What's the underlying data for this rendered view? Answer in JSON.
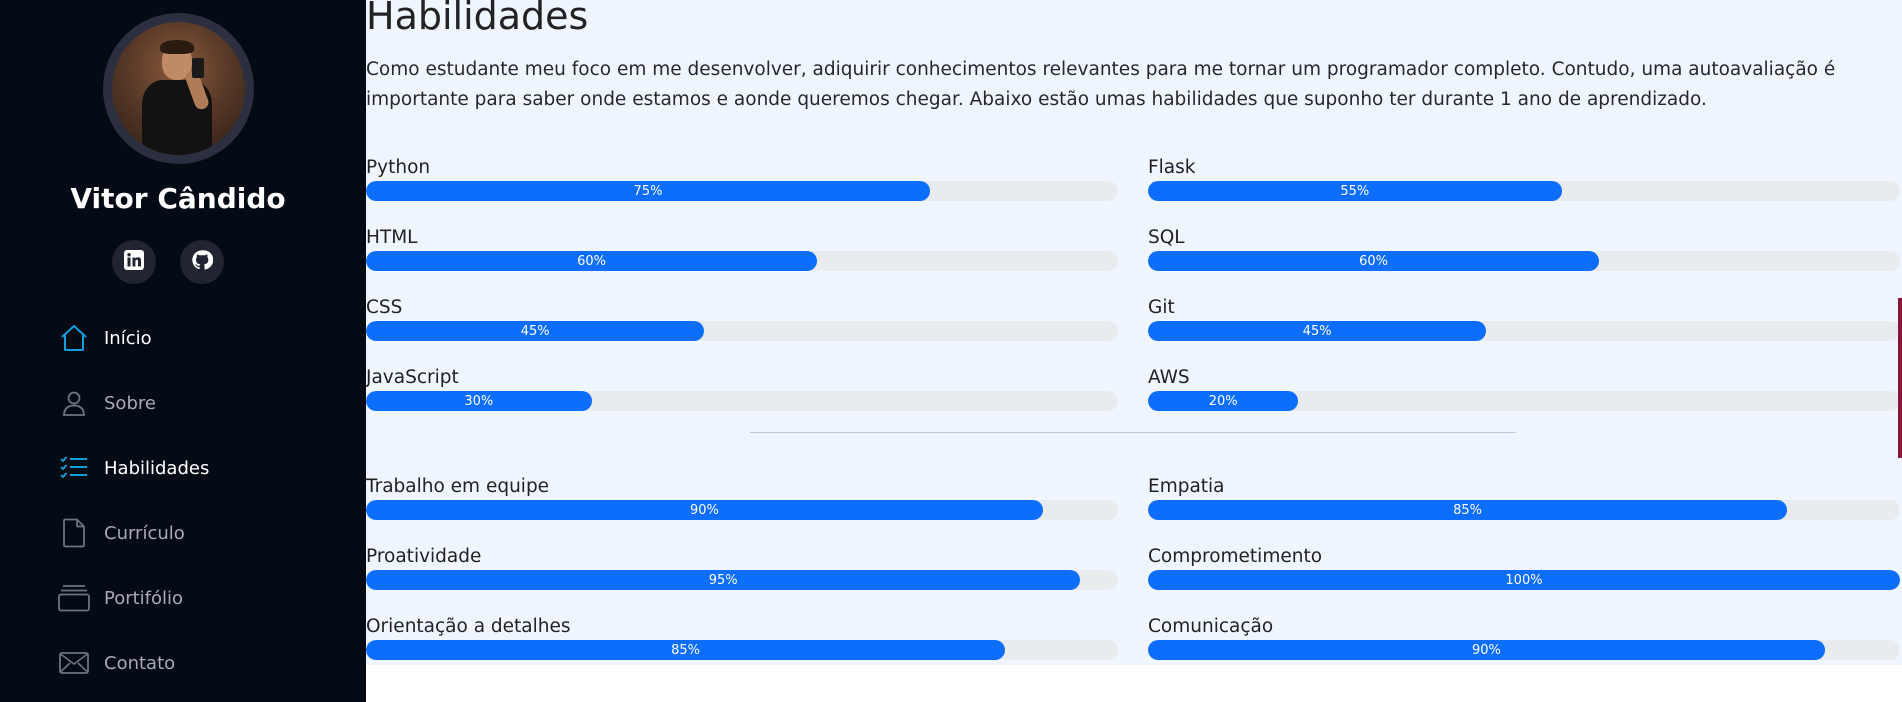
{
  "profile": {
    "name": "Vitor Cândido",
    "social": [
      {
        "icon": "linkedin-icon"
      },
      {
        "icon": "github-icon"
      }
    ]
  },
  "nav": {
    "items": [
      {
        "label": "Início",
        "icon": "home-icon",
        "active": true
      },
      {
        "label": "Sobre",
        "icon": "person-icon",
        "active": false
      },
      {
        "label": "Habilidades",
        "icon": "list-check-icon",
        "active": true
      },
      {
        "label": "Currículo",
        "icon": "file-icon",
        "active": false
      },
      {
        "label": "Portifólio",
        "icon": "portfolio-icon",
        "active": false
      },
      {
        "label": "Contato",
        "icon": "envelope-icon",
        "active": false
      }
    ]
  },
  "section": {
    "title": "Habilidades",
    "description": "Como estudante meu foco em me desenvolver, adiquirir conhecimentos relevantes para me tornar um programador completo. Contudo, uma autoavaliação é importante para saber onde estamos e aonde queremos chegar. Abaixo estão umas habilidades que suponho ter durante 1 ano de aprendizado."
  },
  "technical_skills": [
    {
      "name": "Python",
      "percent": 75,
      "label": "75%"
    },
    {
      "name": "Flask",
      "percent": 55,
      "label": "55%"
    },
    {
      "name": "HTML",
      "percent": 60,
      "label": "60%"
    },
    {
      "name": "SQL",
      "percent": 60,
      "label": "60%"
    },
    {
      "name": "CSS",
      "percent": 45,
      "label": "45%"
    },
    {
      "name": "Git",
      "percent": 45,
      "label": "45%"
    },
    {
      "name": "JavaScript",
      "percent": 30,
      "label": "30%"
    },
    {
      "name": "AWS",
      "percent": 20,
      "label": "20%"
    }
  ],
  "soft_skills": [
    {
      "name": "Trabalho em equipe",
      "percent": 90,
      "label": "90%"
    },
    {
      "name": "Empatia",
      "percent": 85,
      "label": "85%"
    },
    {
      "name": "Proatividade",
      "percent": 95,
      "label": "95%"
    },
    {
      "name": "Comprometimento",
      "percent": 100,
      "label": "100%"
    },
    {
      "name": "Orientação a detalhes",
      "percent": 85,
      "label": "85%"
    },
    {
      "name": "Comunicação",
      "percent": 90,
      "label": "90%"
    }
  ],
  "colors": {
    "sidebar_bg": "#040b14",
    "accent": "#149ddd",
    "bar_fill": "#0d6efd",
    "bar_track": "#e9ecef",
    "main_bg": "#f0f6ff"
  }
}
